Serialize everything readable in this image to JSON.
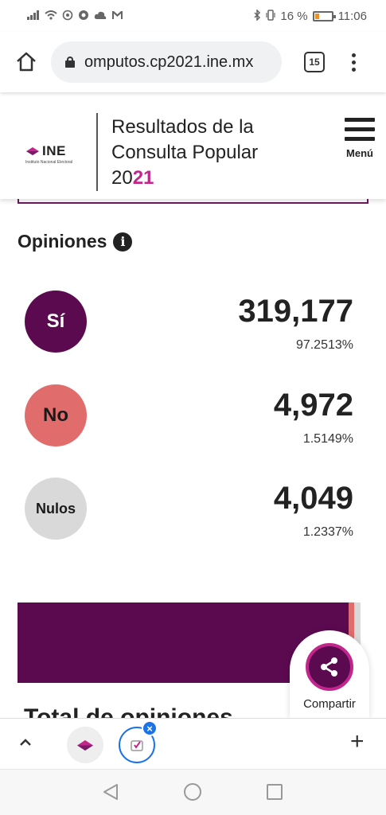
{
  "status_bar": {
    "left_icons": [
      "signal-icon",
      "wifi-icon",
      "whatsapp-icon",
      "chrome-icon",
      "cloud-icon",
      "gmail-icon"
    ],
    "battery_text": "16 %",
    "time": "11:06"
  },
  "browser": {
    "url": "omputos.cp2021.ine.mx",
    "tab_count": "15"
  },
  "header": {
    "logo_text": "INE",
    "logo_subtitle": "Instituto Nacional Electoral",
    "title_line1": "Resultados de la",
    "title_line2": "Consulta Popular",
    "title_year_prefix": "20",
    "title_year_accent": "21",
    "menu_label": "Menú"
  },
  "opinions": {
    "title": "Opiniones",
    "items": [
      {
        "label": "Sí",
        "count": "319,177",
        "percent": "97.2513%",
        "color": "#5c0a50",
        "text_color": "#ffffff"
      },
      {
        "label": "No",
        "count": "4,972",
        "percent": "1.5149%",
        "color": "#e06c6c",
        "text_color": "#1a1a1a"
      },
      {
        "label": "Nulos",
        "count": "4,049",
        "percent": "1.2337%",
        "color": "#d9d9d9",
        "text_color": "#1a1a1a"
      }
    ]
  },
  "bar_chart": {
    "si_color": "#5c0a50",
    "no_color": "#e06c6c",
    "nulos_color": "#d9d9d9"
  },
  "total_title": "Total de opiniones",
  "share": {
    "label": "Compartir"
  },
  "tab_strip": {
    "close_badge": "×"
  }
}
